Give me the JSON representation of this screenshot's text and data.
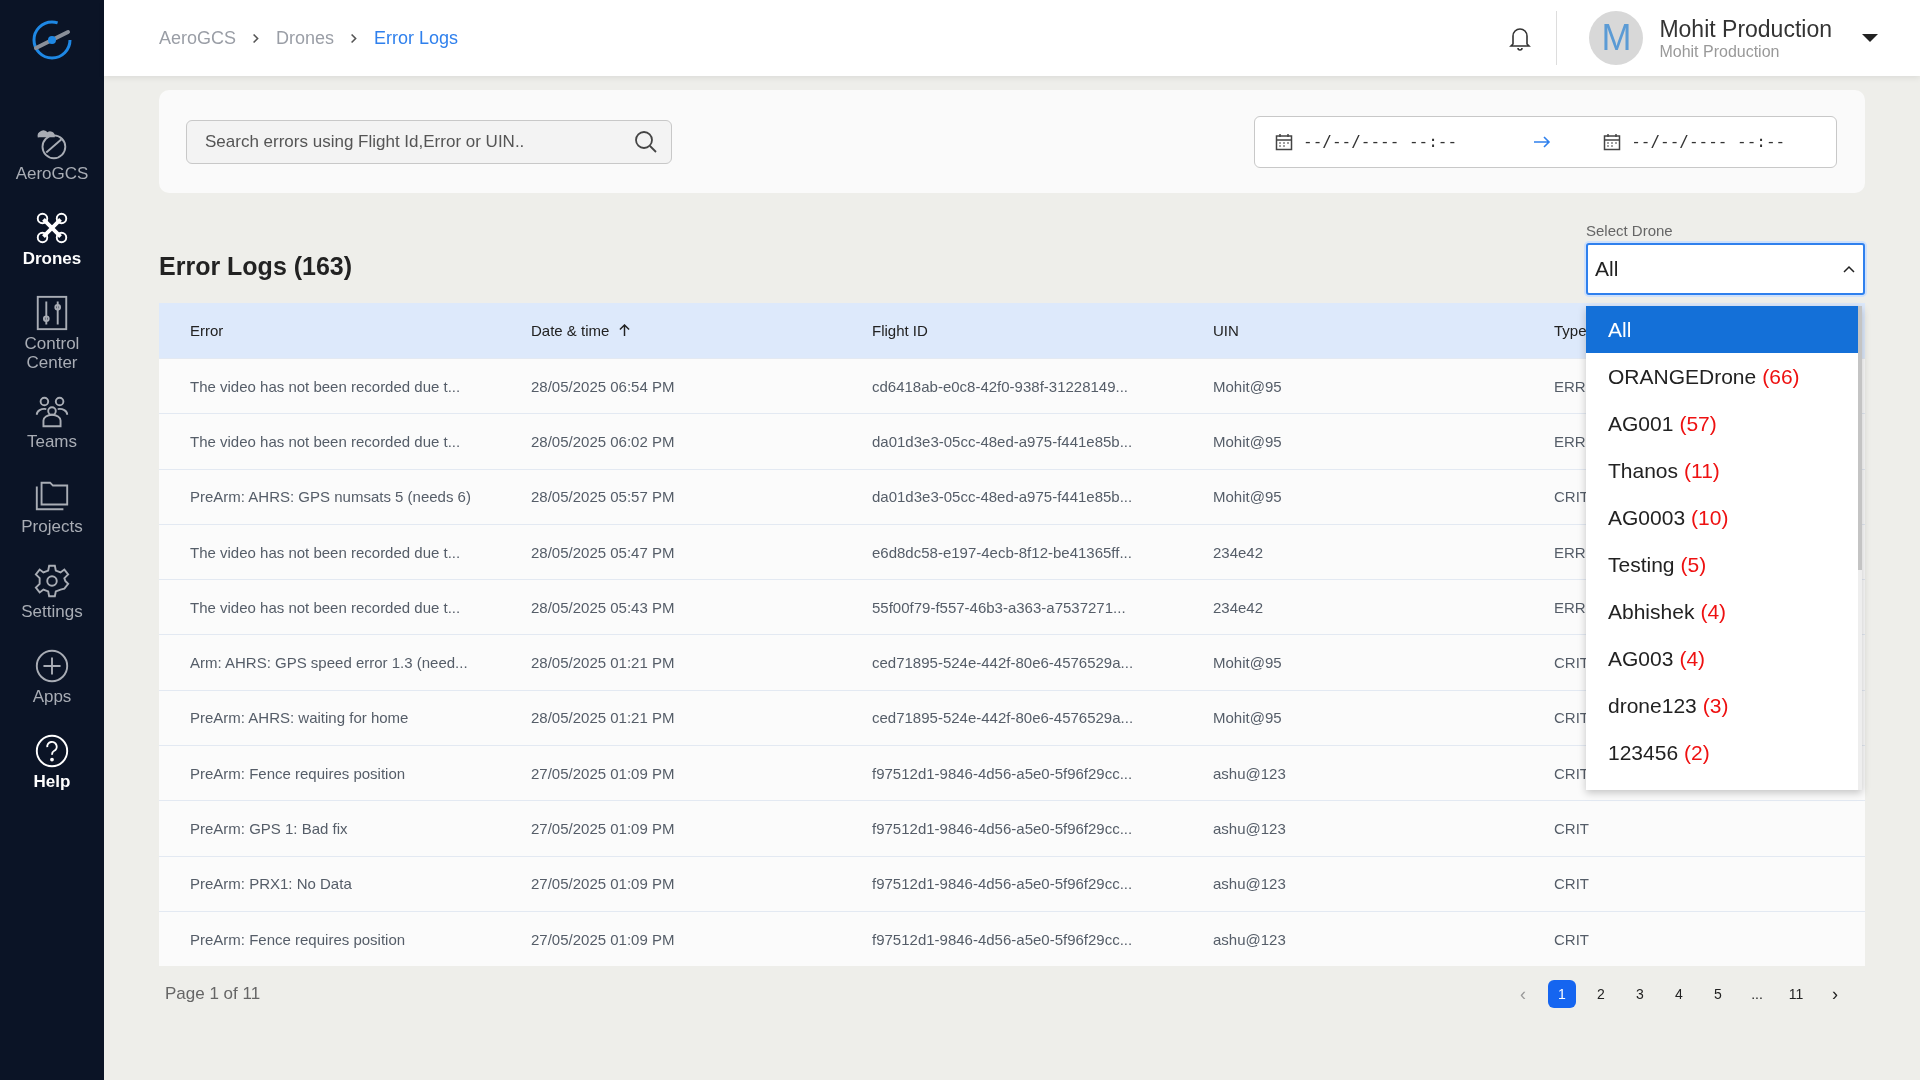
{
  "sidebar": {
    "items": [
      {
        "label": "AeroGCS",
        "active": false
      },
      {
        "label": "Drones",
        "active": true
      },
      {
        "label": "Control Center",
        "active": false
      },
      {
        "label": "Teams",
        "active": false
      },
      {
        "label": "Projects",
        "active": false
      },
      {
        "label": "Settings",
        "active": false
      },
      {
        "label": "Apps",
        "active": false
      },
      {
        "label": "Help",
        "active": true
      }
    ]
  },
  "breadcrumbs": [
    {
      "label": "AeroGCS",
      "current": false
    },
    {
      "label": "Drones",
      "current": false
    },
    {
      "label": "Error Logs",
      "current": true
    }
  ],
  "user": {
    "initial": "M",
    "name": "Mohit Production",
    "subtitle": "Mohit Production"
  },
  "search": {
    "placeholder": "Search errors using Flight Id,Error or UIN.."
  },
  "date_range": {
    "start_placeholder": "--/--/---- --:--",
    "end_placeholder": "--/--/---- --:--"
  },
  "title": "Error Logs (163)",
  "select_drone": {
    "label": "Select Drone",
    "value": "All",
    "expanded": true,
    "options": [
      {
        "name": "All",
        "selected": true
      },
      {
        "name": "ORANGEDrone",
        "count": "(66)",
        "selected": false
      },
      {
        "name": "AG001",
        "count": "(57)",
        "selected": false
      },
      {
        "name": "Thanos",
        "count": "(11)",
        "selected": false
      },
      {
        "name": "AG0003",
        "count": "(10)",
        "selected": false
      },
      {
        "name": "Testing",
        "count": "(5)",
        "selected": false
      },
      {
        "name": "Abhishek",
        "count": "(4)",
        "selected": false
      },
      {
        "name": "AG003",
        "count": "(4)",
        "selected": false
      },
      {
        "name": "drone123",
        "count": "(3)",
        "selected": false
      },
      {
        "name": "123456",
        "count": "(2)",
        "selected": false
      }
    ]
  },
  "table": {
    "columns": [
      {
        "label": "Error",
        "sorted": false
      },
      {
        "label": "Date & time",
        "sorted": true
      },
      {
        "label": "Flight ID",
        "sorted": false
      },
      {
        "label": "UIN",
        "sorted": false
      },
      {
        "label": "Type",
        "sorted": false
      }
    ],
    "rows": [
      {
        "error": "The video has not been recorded due t...",
        "datetime": "28/05/2025 06:54 PM",
        "flight_id": "cd6418ab-e0c8-42f0-938f-31228149...",
        "uin": "Mohit@95",
        "type": "ERR"
      },
      {
        "error": "The video has not been recorded due t...",
        "datetime": "28/05/2025 06:02 PM",
        "flight_id": "da01d3e3-05cc-48ed-a975-f441e85b...",
        "uin": "Mohit@95",
        "type": "ERR"
      },
      {
        "error": "PreArm: AHRS: GPS numsats 5 (needs 6)",
        "datetime": "28/05/2025 05:57 PM",
        "flight_id": "da01d3e3-05cc-48ed-a975-f441e85b...",
        "uin": "Mohit@95",
        "type": "CRIT"
      },
      {
        "error": "The video has not been recorded due t...",
        "datetime": "28/05/2025 05:47 PM",
        "flight_id": "e6d8dc58-e197-4ecb-8f12-be41365ff...",
        "uin": "234e42",
        "type": "ERR"
      },
      {
        "error": "The video has not been recorded due t...",
        "datetime": "28/05/2025 05:43 PM",
        "flight_id": "55f00f79-f557-46b3-a363-a7537271...",
        "uin": "234e42",
        "type": "ERR"
      },
      {
        "error": "Arm: AHRS: GPS speed error 1.3 (need...",
        "datetime": "28/05/2025 01:21 PM",
        "flight_id": "ced71895-524e-442f-80e6-4576529a...",
        "uin": "Mohit@95",
        "type": "CRIT"
      },
      {
        "error": "PreArm: AHRS: waiting for home",
        "datetime": "28/05/2025 01:21 PM",
        "flight_id": "ced71895-524e-442f-80e6-4576529a...",
        "uin": "Mohit@95",
        "type": "CRIT"
      },
      {
        "error": "PreArm: Fence requires position",
        "datetime": "27/05/2025 01:09 PM",
        "flight_id": "f97512d1-9846-4d56-a5e0-5f96f29cc...",
        "uin": "ashu@123",
        "type": "CRIT"
      },
      {
        "error": "PreArm: GPS 1: Bad fix",
        "datetime": "27/05/2025 01:09 PM",
        "flight_id": "f97512d1-9846-4d56-a5e0-5f96f29cc...",
        "uin": "ashu@123",
        "type": "CRIT"
      },
      {
        "error": "PreArm: PRX1: No Data",
        "datetime": "27/05/2025 01:09 PM",
        "flight_id": "f97512d1-9846-4d56-a5e0-5f96f29cc...",
        "uin": "ashu@123",
        "type": "CRIT"
      },
      {
        "error": "PreArm: Fence requires position",
        "datetime": "27/05/2025 01:09 PM",
        "flight_id": "f97512d1-9846-4d56-a5e0-5f96f29cc...",
        "uin": "ashu@123",
        "type": "CRIT"
      }
    ]
  },
  "pagination": {
    "summary": "Page 1 of 11",
    "prev": "‹",
    "next": "›",
    "pages": [
      {
        "label": "1",
        "selected": true
      },
      {
        "label": "2",
        "selected": false
      },
      {
        "label": "3",
        "selected": false
      },
      {
        "label": "4",
        "selected": false
      },
      {
        "label": "5",
        "selected": false
      },
      {
        "label": "...",
        "selected": false
      },
      {
        "label": "11",
        "selected": false
      }
    ]
  }
}
